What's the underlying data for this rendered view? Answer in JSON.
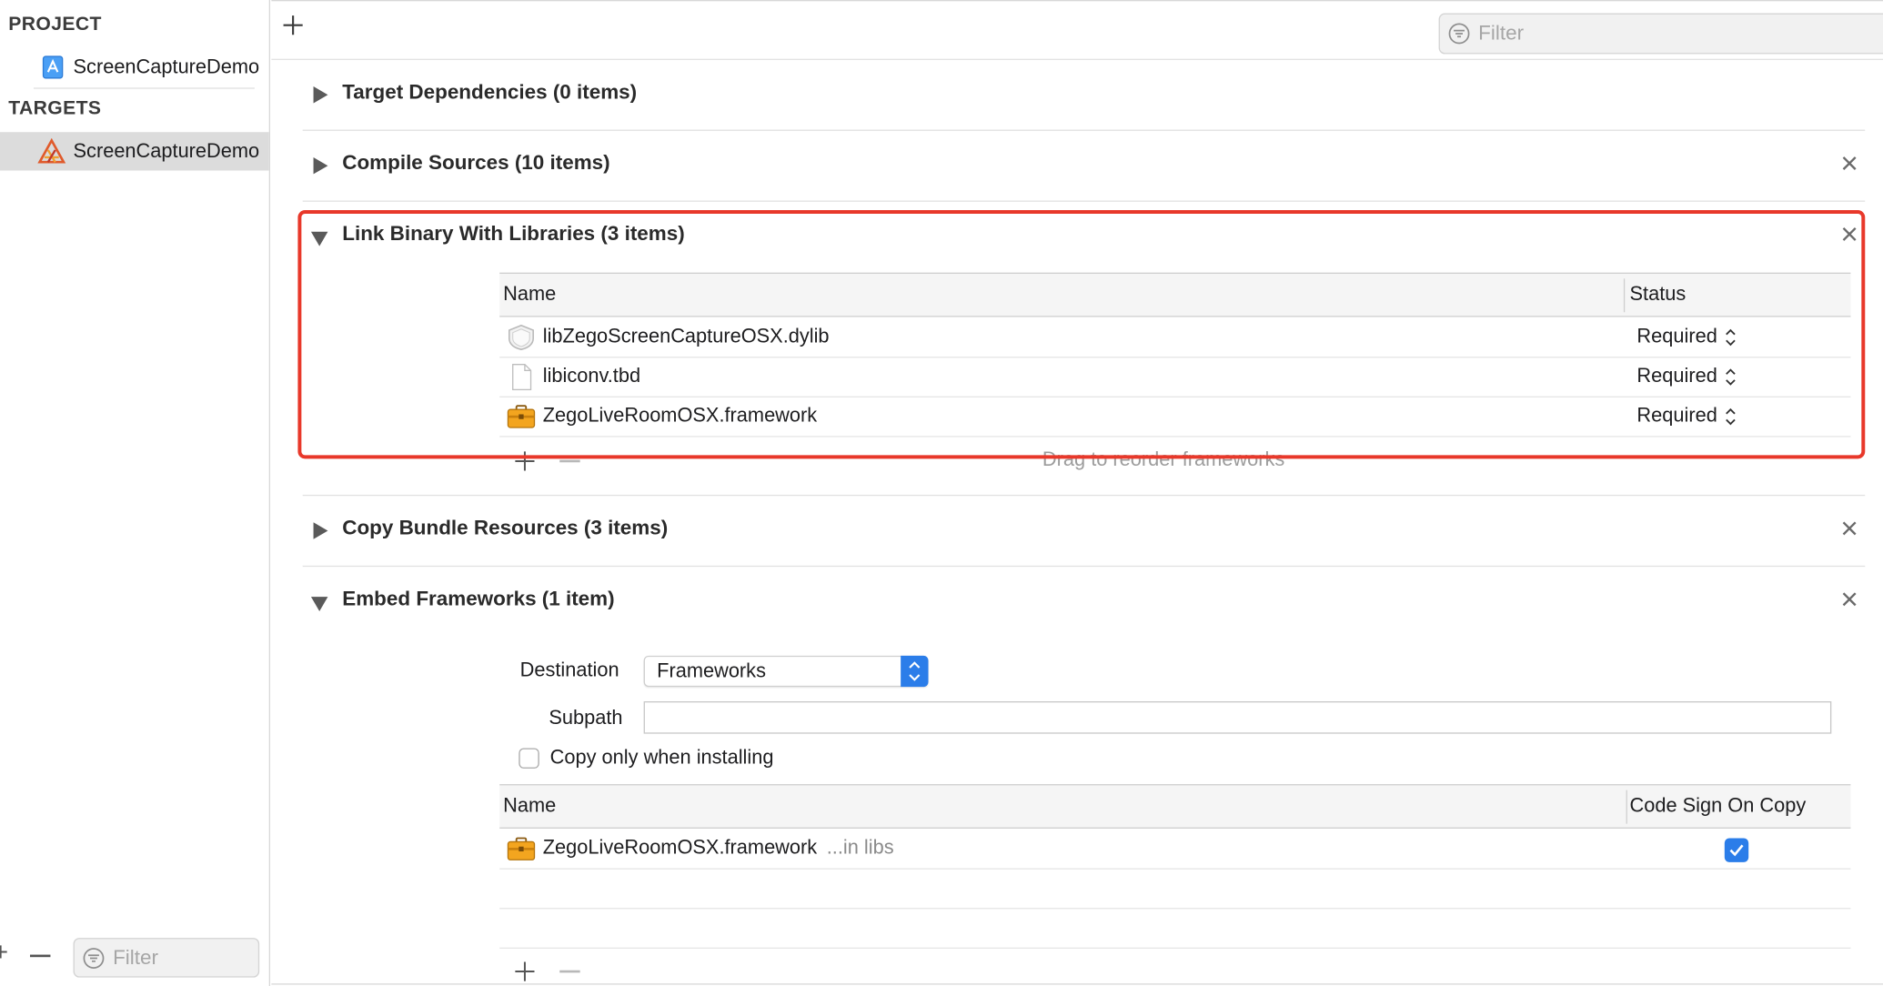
{
  "sidebar": {
    "project_heading": "PROJECT",
    "project_item": "ScreenCaptureDemo",
    "targets_heading": "TARGETS",
    "target_item": "ScreenCaptureDemo",
    "filter_placeholder": "Filter"
  },
  "toolbar": {
    "filter_placeholder": "Filter"
  },
  "phases": {
    "target_deps": "Target Dependencies (0 items)",
    "compile_sources": "Compile Sources (10 items)",
    "link_binary": "Link Binary With Libraries (3 items)",
    "copy_bundle": "Copy Bundle Resources (3 items)",
    "embed_frameworks": "Embed Frameworks (1 item)"
  },
  "link_table": {
    "col_name": "Name",
    "col_status": "Status",
    "rows": [
      {
        "name": "libZegoScreenCaptureOSX.dylib",
        "status": "Required",
        "icon": "dylib-icon"
      },
      {
        "name": "libiconv.tbd",
        "status": "Required",
        "icon": "file-icon"
      },
      {
        "name": "ZegoLiveRoomOSX.framework",
        "status": "Required",
        "icon": "framework-icon"
      }
    ],
    "drag_hint": "Drag to reorder frameworks"
  },
  "embed": {
    "destination_label": "Destination",
    "destination_value": "Frameworks",
    "subpath_label": "Subpath",
    "subpath_value": "",
    "copy_only_label": "Copy only when installing",
    "copy_only_checked": false,
    "col_name": "Name",
    "col_codesign": "Code Sign On Copy",
    "rows": [
      {
        "name": "ZegoLiveRoomOSX.framework",
        "location": "...in libs",
        "code_sign": true,
        "icon": "framework-icon"
      }
    ]
  },
  "colors": {
    "highlight_border": "#e8382a",
    "accent_blue": "#2b7de9"
  }
}
